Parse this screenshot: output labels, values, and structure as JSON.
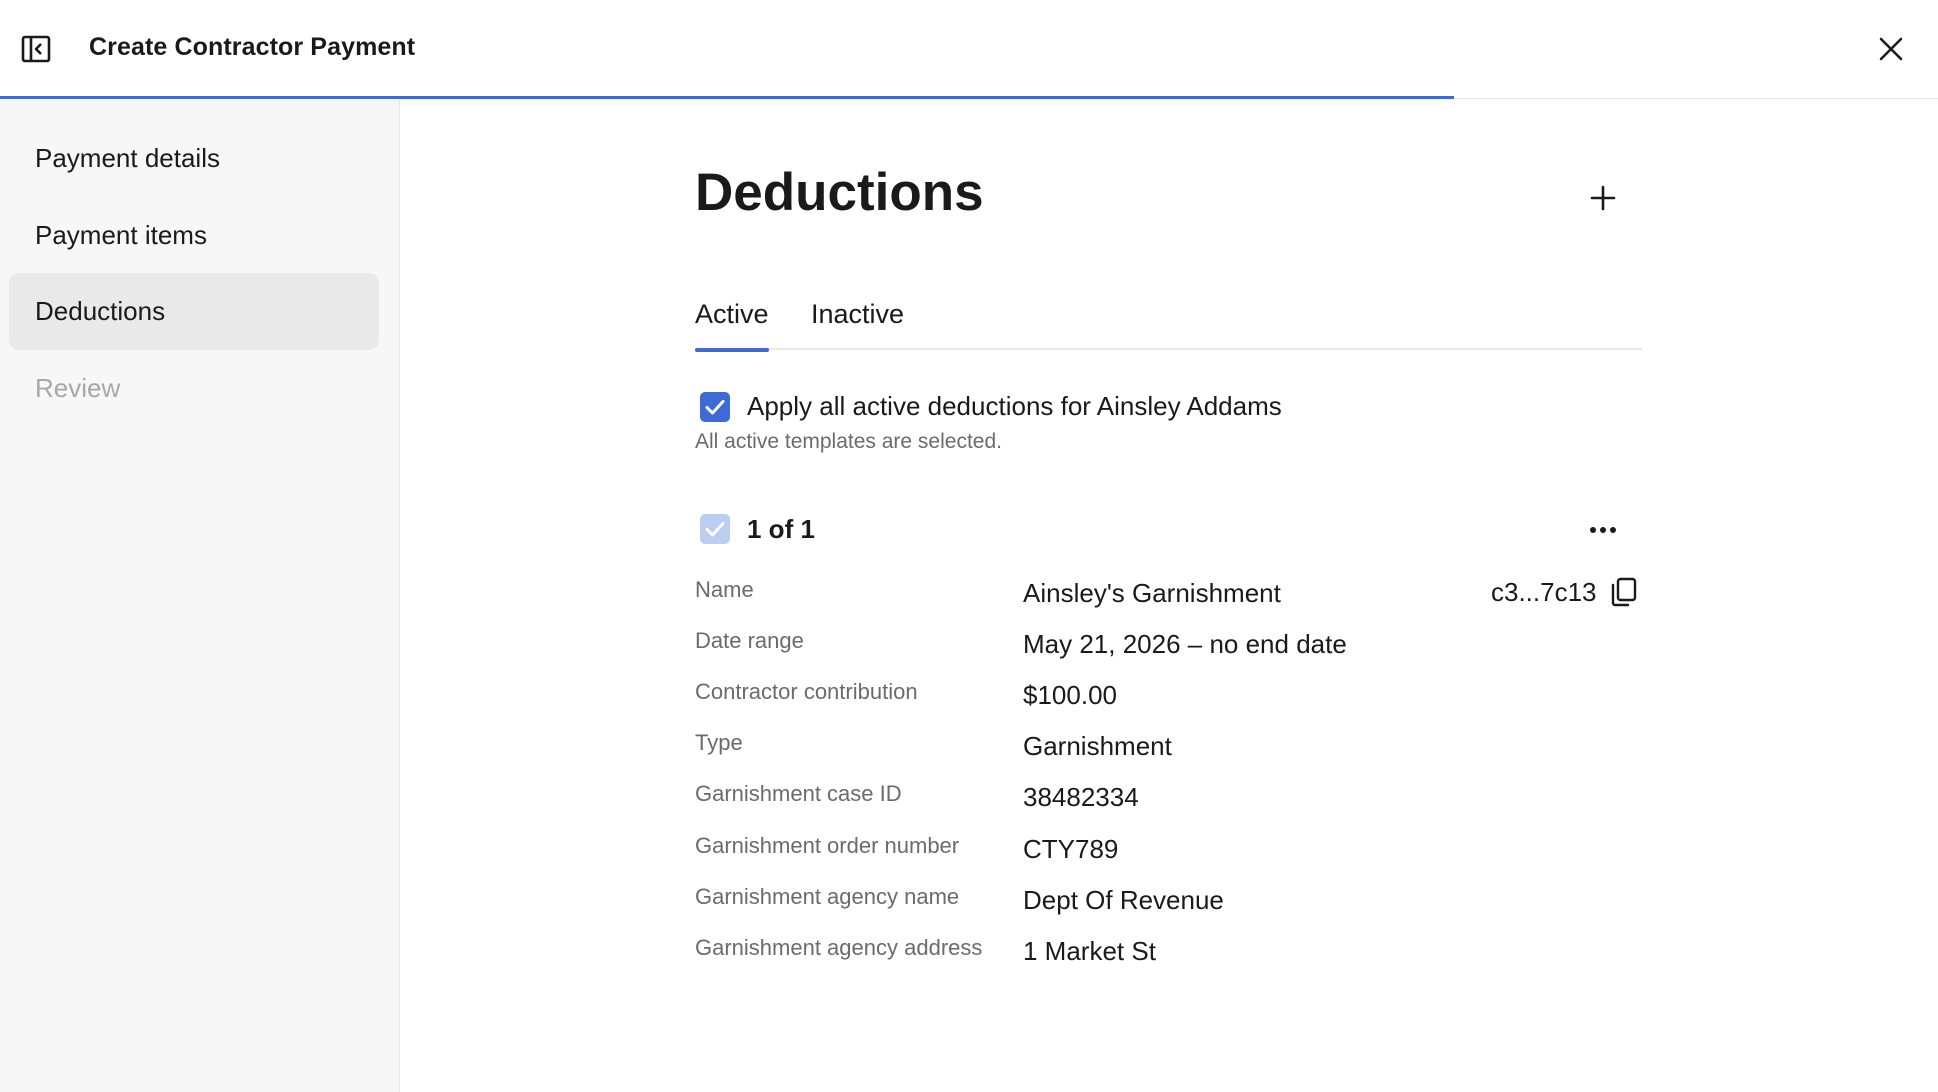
{
  "header": {
    "title": "Create Contractor Payment",
    "progress_fraction": 0.75,
    "accent_color": "#3e6ad8"
  },
  "sidebar": {
    "items": [
      {
        "label": "Payment details",
        "state": "default"
      },
      {
        "label": "Payment items",
        "state": "default"
      },
      {
        "label": "Deductions",
        "state": "active"
      },
      {
        "label": "Review",
        "state": "disabled"
      }
    ]
  },
  "main": {
    "title": "Deductions",
    "tabs": [
      {
        "label": "Active",
        "selected": true
      },
      {
        "label": "Inactive",
        "selected": false
      }
    ],
    "apply_all": {
      "checked": true,
      "label": "Apply all active deductions for Ainsley Addams",
      "helper": "All active templates are selected."
    },
    "deduction_card": {
      "count_label": "1 of 1",
      "id_short": "c3...7c13",
      "fields": [
        {
          "label": "Name",
          "value": "Ainsley's Garnishment"
        },
        {
          "label": "Date range",
          "value": "May 21, 2026 – no end date"
        },
        {
          "label": "Contractor contribution",
          "value": "$100.00"
        },
        {
          "label": "Type",
          "value": "Garnishment"
        },
        {
          "label": "Garnishment case ID",
          "value": "38482334"
        },
        {
          "label": "Garnishment order number",
          "value": "CTY789"
        },
        {
          "label": "Garnishment agency name",
          "value": "Dept Of Revenue"
        },
        {
          "label": "Garnishment agency address",
          "value": "1 Market St"
        }
      ]
    }
  },
  "icons": {
    "sidebar_toggle": "sidebar-collapse-icon",
    "close": "close-icon",
    "add": "plus-icon",
    "more": "more-horizontal-icon",
    "copy": "copy-icon",
    "check": "checkmark-icon"
  }
}
